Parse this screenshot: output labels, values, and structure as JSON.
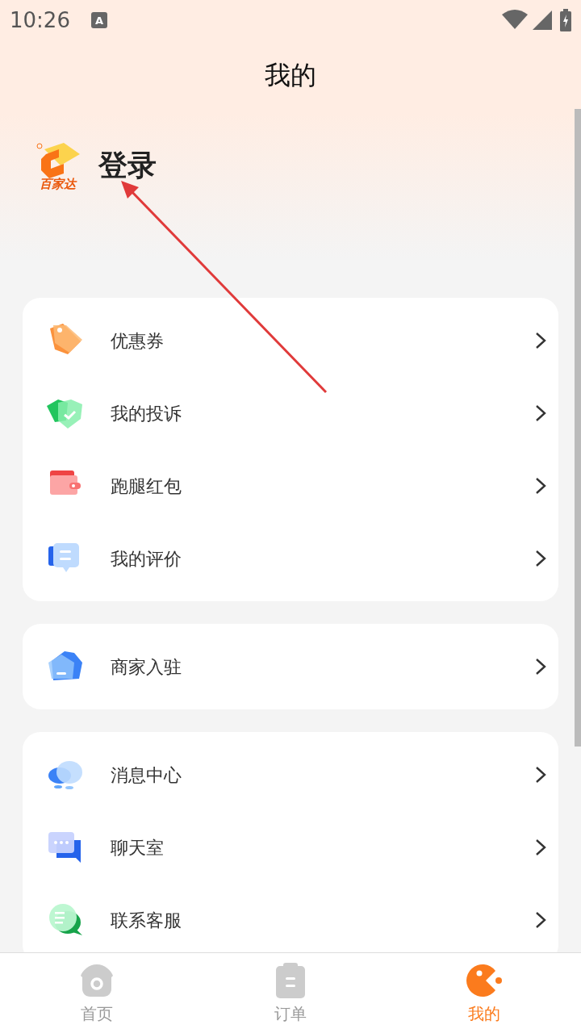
{
  "status_bar": {
    "time": "10:26",
    "keyboard_badge": "A"
  },
  "header": {
    "title": "我的"
  },
  "profile": {
    "logo_text": "百家达",
    "login": "登录"
  },
  "groups": [
    {
      "items": [
        {
          "label": "优惠券"
        },
        {
          "label": "我的投诉"
        },
        {
          "label": "跑腿红包"
        },
        {
          "label": "我的评价"
        }
      ]
    },
    {
      "items": [
        {
          "label": "商家入驻"
        }
      ]
    },
    {
      "items": [
        {
          "label": "消息中心"
        },
        {
          "label": "聊天室"
        },
        {
          "label": "联系客服"
        }
      ]
    }
  ],
  "tabs": [
    {
      "label": "首页",
      "selected": false
    },
    {
      "label": "订单",
      "selected": false
    },
    {
      "label": "我的",
      "selected": true
    }
  ]
}
